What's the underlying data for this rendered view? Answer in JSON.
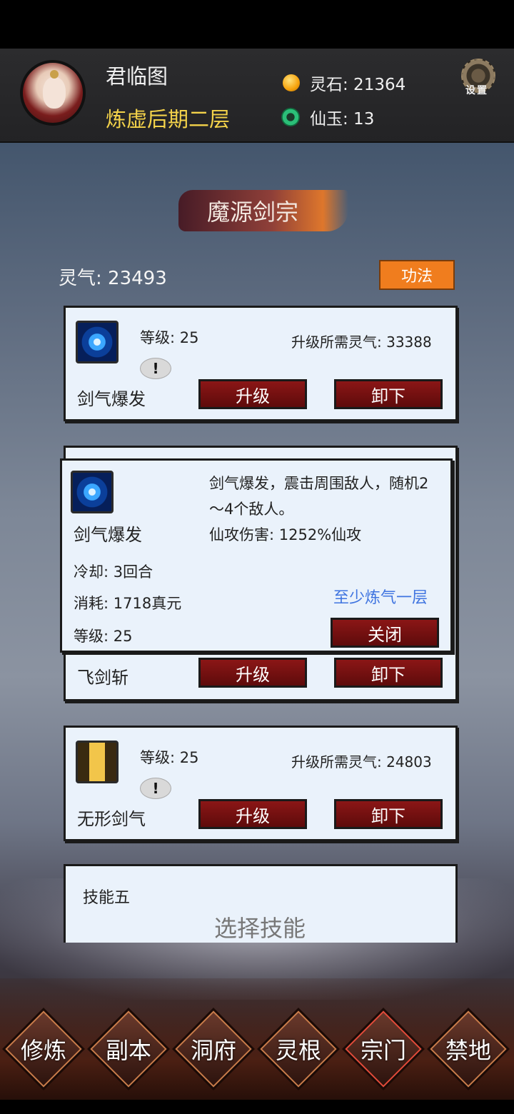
{
  "header": {
    "player_name": "君临图",
    "realm": "炼虚后期二层",
    "lingshi": "灵石: 21364",
    "xianyu": "仙玉: 13",
    "settings_label": "设置"
  },
  "sect": {
    "title": "魔源剑宗",
    "lingqi": "灵气: 23493",
    "gongfa_button": "功法"
  },
  "skills": [
    {
      "name": "剑气爆发",
      "level": "等级: 25",
      "need": "升级所需灵气: 33388",
      "alert": "!",
      "upgrade": "升级",
      "unequip": "卸下"
    },
    {
      "name": "飞剑斩",
      "upgrade": "升级",
      "unequip": "卸下"
    },
    {
      "name": "无形剑气",
      "level": "等级: 25",
      "need": "升级所需灵气: 24803",
      "alert": "!",
      "upgrade": "升级",
      "unequip": "卸下"
    }
  ],
  "popup": {
    "name": "剑气爆发",
    "desc_line1": "剑气爆发，震击周围敌人，随机2",
    "desc_line2": "～4个敌人。",
    "damage": "仙攻伤害: 1252%仙攻",
    "cooldown": "冷却: 3回合",
    "cost": "消耗: 1718真元",
    "level": "等级: 25",
    "requirement": "至少炼气一层",
    "close": "关闭"
  },
  "slot5": {
    "label": "技能五",
    "select": "选择技能"
  },
  "nav": [
    "修炼",
    "副本",
    "洞府",
    "灵根",
    "宗门",
    "禁地"
  ],
  "colors": {
    "realm_gold": "#f4d34a",
    "button_red": "#8b1616",
    "gongfa_orange": "#f07d1e",
    "card_bg": "#eaf2fb",
    "requirement_blue": "#3f74e0"
  }
}
